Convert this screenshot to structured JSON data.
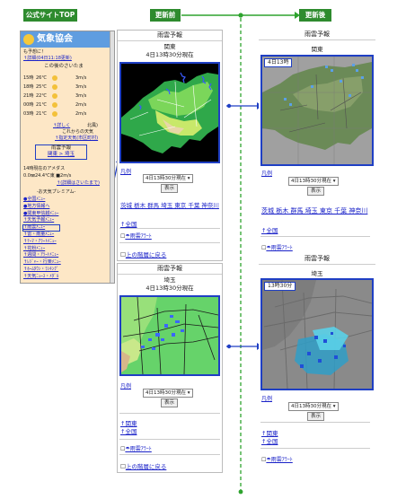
{
  "labels": {
    "official_top": "公式サイトTOP",
    "before": "更新前",
    "after": "更新後"
  },
  "phone": {
    "logo": "気象協会",
    "line1": "も予想に！",
    "line2": "↑詳細(04日11:18更新)",
    "section": "この後のさいたま",
    "forecast": [
      {
        "time": "15時",
        "temp": "26℃",
        "wind": "3m/s"
      },
      {
        "time": "18時",
        "temp": "25℃",
        "wind": "3m/s"
      },
      {
        "time": "21時",
        "temp": "22℃",
        "wind": "3m/s"
      },
      {
        "time": "00時",
        "temp": "21℃",
        "wind": "2m/s"
      },
      {
        "time": "03時",
        "temp": "21℃",
        "wind": "2m/s"
      }
    ],
    "detail": "↑詳しく",
    "north": "北風)",
    "next": "これからの天気",
    "pinpoint": "↑指定天気(市区町村)",
    "radar_label": "雨雲予報",
    "radar_links": "関東 > 埼玉",
    "amedas": "14時現在のアメダス",
    "amedas_val": "0.0㎜24.4℃東 ■2m/s",
    "amedas_link": "↑(詳細はさいたまで)",
    "premium": "-お天気プレミアム-",
    "menu": [
      "●全国ﾒﾆｭｰ",
      "●地方情報へ",
      "●関東甲信越ﾒﾆｭｰ",
      "↑天気予報ﾒﾆｭｰ",
      "↑雨雲ﾒﾆｭｰ",
      "↑雷・雨量ﾒﾆｭｰ",
      "↑ﾃｰﾏ・ｱﾗｰﾄﾒﾆｭｰ",
      "↑花粉ﾒﾆｭｰ",
      "↑週間・ｱﾗｰﾄﾒﾆｭｰ",
      "↑ﾚｼﾞｬｰ・行楽ﾒﾆｭｰ",
      "↑ﾎｰﾑﾀｳﾝ・ﾗﾝｷﾝｸﾞ",
      "↑天気ﾆｭｰｽ・ﾒﾀﾞﾙ"
    ]
  },
  "before_kanto": {
    "header": "雨雲予報",
    "region": "関東",
    "time": "4日13時30分現在",
    "legend": "凡例",
    "select": "4日13時30分現在",
    "button": "表示",
    "prefs": "茨城 栃木 群馬 埼玉 東京 千葉 神奈川",
    "national": "↑全国",
    "alert": "☂雨雲ｱﾗｰﾄ",
    "back": "上の階層に戻る"
  },
  "before_saitama": {
    "header": "雨雲予報",
    "region": "埼玉",
    "time": "4日13時30分現在",
    "legend": "凡例",
    "select": "4日13時30分現在",
    "button": "表示",
    "kanto": "↑関東",
    "national": "↑全国",
    "alert": "☂雨雲ｱﾗｰﾄ",
    "back": "上の階層に戻る"
  },
  "after_kanto": {
    "header": "雨雲予報",
    "region": "関東",
    "badge": "4日13時",
    "legend": "凡例",
    "select": "4日13時30分現在",
    "button": "表示",
    "prefs": "茨城 栃木 群馬 埼玉 東京 千葉 神奈川",
    "national": "↑全国",
    "alert": "☂雨雲ｱﾗｰﾄ"
  },
  "after_saitama": {
    "header": "雨雲予報",
    "region": "埼玉",
    "badge": "13時30分",
    "legend": "凡例",
    "select": "4日13時30分現在",
    "button": "表示",
    "kanto": "↑関東",
    "national": "↑全国",
    "alert": "☂雨雲ｱﾗｰﾄ"
  },
  "colors": {
    "tag": "#2e8b2e",
    "accent_blue": "#1f3fc4",
    "guide_green": "#2ea32e"
  }
}
